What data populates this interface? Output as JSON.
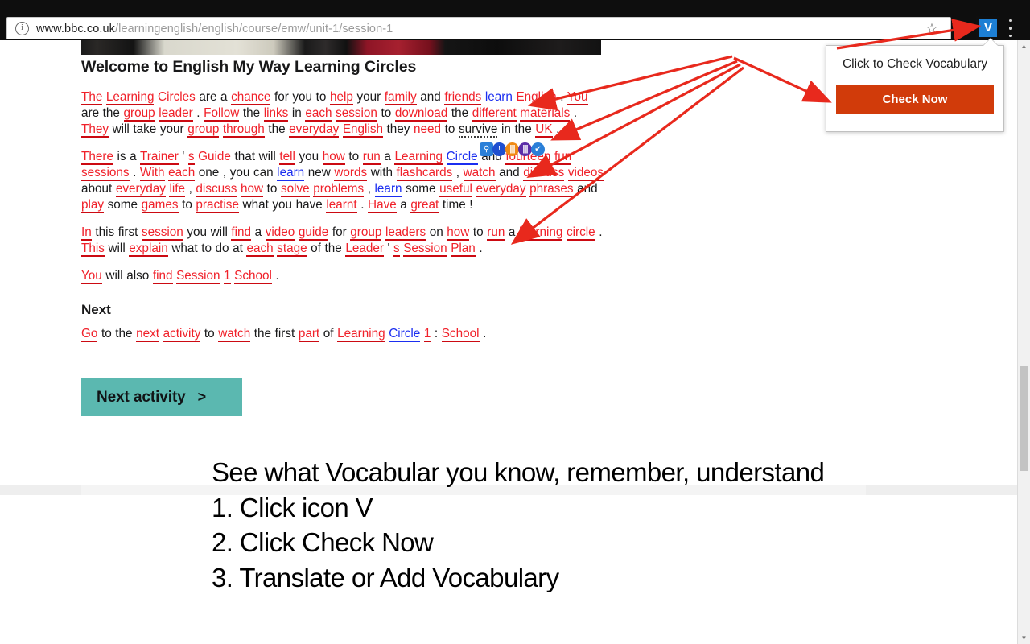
{
  "browser": {
    "url_host": "www.bbc.co.uk",
    "url_path": "/learningenglish/english/course/emw/unit-1/session-1",
    "info_icon": "info-icon",
    "star_icon": "☆",
    "extension_label": "V",
    "menu_icon": "kebab-menu-icon"
  },
  "popup": {
    "title": "Click to Check Vocabulary",
    "button_label": "Check Now",
    "button_color": "#d13b0a"
  },
  "article": {
    "title": "Welcome to English My Way Learning Circles",
    "next_heading": "Next",
    "paragraphs": [
      [
        {
          "t": "The",
          "s": "redu"
        },
        {
          "t": "Learning",
          "s": "redu"
        },
        {
          "t": "Circles",
          "s": "red"
        },
        {
          "t": "are",
          "s": "plain"
        },
        {
          "t": "a",
          "s": "plain"
        },
        {
          "t": "chance",
          "s": "redu"
        },
        {
          "t": "for",
          "s": "plain"
        },
        {
          "t": "you",
          "s": "plain"
        },
        {
          "t": "to",
          "s": "plain"
        },
        {
          "t": "help",
          "s": "redu"
        },
        {
          "t": "your",
          "s": "plain"
        },
        {
          "t": "family",
          "s": "redu"
        },
        {
          "t": "and",
          "s": "plain"
        },
        {
          "t": "friends",
          "s": "redu"
        },
        {
          "t": "learn",
          "s": "blue"
        },
        {
          "t": "English",
          "s": "red"
        },
        {
          "t": ".",
          "s": "plain"
        },
        {
          "t": "You",
          "s": "redu"
        },
        {
          "t": "are",
          "s": "plain"
        },
        {
          "t": "the",
          "s": "plain"
        },
        {
          "t": "group",
          "s": "redu"
        },
        {
          "t": "leader",
          "s": "redu"
        },
        {
          "t": ".",
          "s": "plain"
        },
        {
          "t": "Follow",
          "s": "redu"
        },
        {
          "t": "the",
          "s": "plain"
        },
        {
          "t": "links",
          "s": "redu"
        },
        {
          "t": "in",
          "s": "plain"
        },
        {
          "t": "each",
          "s": "redu"
        },
        {
          "t": "session",
          "s": "redu"
        },
        {
          "t": "to",
          "s": "plain"
        },
        {
          "t": "download",
          "s": "redu"
        },
        {
          "t": "the",
          "s": "plain"
        },
        {
          "t": "different",
          "s": "redu"
        },
        {
          "t": "materials",
          "s": "redu"
        },
        {
          "t": ".",
          "s": "plain"
        },
        {
          "t": "They",
          "s": "redu"
        },
        {
          "t": "will",
          "s": "plain"
        },
        {
          "t": "take",
          "s": "plain"
        },
        {
          "t": "your",
          "s": "plain"
        },
        {
          "t": "group",
          "s": "redu"
        },
        {
          "t": "through",
          "s": "redu"
        },
        {
          "t": "the",
          "s": "plain"
        },
        {
          "t": "everyday",
          "s": "redu"
        },
        {
          "t": "English",
          "s": "redu"
        },
        {
          "t": "they",
          "s": "plain"
        },
        {
          "t": "need",
          "s": "red"
        },
        {
          "t": "to",
          "s": "plain"
        },
        {
          "t": "survive",
          "s": "spell"
        },
        {
          "t": "in",
          "s": "plain"
        },
        {
          "t": "the",
          "s": "plain"
        },
        {
          "t": "UK",
          "s": "redu"
        },
        {
          "t": ".",
          "s": "plain"
        }
      ],
      [
        {
          "t": "There",
          "s": "redu"
        },
        {
          "t": "is",
          "s": "plain"
        },
        {
          "t": "a",
          "s": "plain"
        },
        {
          "t": "Trainer",
          "s": "redu"
        },
        {
          "t": "'",
          "s": "plain"
        },
        {
          "t": "s",
          "s": "redu"
        },
        {
          "t": "Guide",
          "s": "red"
        },
        {
          "t": "that",
          "s": "plain"
        },
        {
          "t": "will",
          "s": "plain"
        },
        {
          "t": "tell",
          "s": "redu"
        },
        {
          "t": "you",
          "s": "plain"
        },
        {
          "t": "how",
          "s": "redu"
        },
        {
          "t": "to",
          "s": "plain"
        },
        {
          "t": "run",
          "s": "redu"
        },
        {
          "t": "a",
          "s": "plain"
        },
        {
          "t": "Learning",
          "s": "redu"
        },
        {
          "t": "Circle",
          "s": "blueu"
        },
        {
          "t": "and",
          "s": "plain"
        },
        {
          "t": "fourteen",
          "s": "redu"
        },
        {
          "t": "fun",
          "s": "redu"
        },
        {
          "t": "sessions",
          "s": "redu"
        },
        {
          "t": ".",
          "s": "plain"
        },
        {
          "t": "With",
          "s": "redu"
        },
        {
          "t": "each",
          "s": "redu"
        },
        {
          "t": "one",
          "s": "plain"
        },
        {
          "t": ",",
          "s": "plain"
        },
        {
          "t": "you",
          "s": "plain"
        },
        {
          "t": "can",
          "s": "plain"
        },
        {
          "t": "learn",
          "s": "blueu"
        },
        {
          "t": "new",
          "s": "plain"
        },
        {
          "t": "words",
          "s": "redu"
        },
        {
          "t": "with",
          "s": "plain"
        },
        {
          "t": "flashcards",
          "s": "redu"
        },
        {
          "t": ",",
          "s": "plain"
        },
        {
          "t": "watch",
          "s": "redu"
        },
        {
          "t": "and",
          "s": "plain"
        },
        {
          "t": "discuss",
          "s": "redu"
        },
        {
          "t": "videos",
          "s": "redu"
        },
        {
          "t": "about",
          "s": "plain"
        },
        {
          "t": "everyday",
          "s": "redu"
        },
        {
          "t": "life",
          "s": "redu"
        },
        {
          "t": ",",
          "s": "plain"
        },
        {
          "t": "discuss",
          "s": "redu"
        },
        {
          "t": "how",
          "s": "redu"
        },
        {
          "t": "to",
          "s": "plain"
        },
        {
          "t": "solve",
          "s": "redu"
        },
        {
          "t": "problems",
          "s": "redu"
        },
        {
          "t": ",",
          "s": "plain"
        },
        {
          "t": "learn",
          "s": "blueu"
        },
        {
          "t": "some",
          "s": "plain"
        },
        {
          "t": "useful",
          "s": "redu"
        },
        {
          "t": "everyday",
          "s": "redu"
        },
        {
          "t": "phrases",
          "s": "redu"
        },
        {
          "t": "and",
          "s": "plain"
        },
        {
          "t": "play",
          "s": "redu"
        },
        {
          "t": "some",
          "s": "plain"
        },
        {
          "t": "games",
          "s": "redu"
        },
        {
          "t": "to",
          "s": "plain"
        },
        {
          "t": "practise",
          "s": "redu"
        },
        {
          "t": "what",
          "s": "plain"
        },
        {
          "t": "you",
          "s": "plain"
        },
        {
          "t": "have",
          "s": "plain"
        },
        {
          "t": "learnt",
          "s": "redu"
        },
        {
          "t": ".",
          "s": "plain"
        },
        {
          "t": "Have",
          "s": "redu"
        },
        {
          "t": "a",
          "s": "plain"
        },
        {
          "t": "great",
          "s": "redu"
        },
        {
          "t": "time",
          "s": "plain"
        },
        {
          "t": "!",
          "s": "plain"
        }
      ],
      [
        {
          "t": "In",
          "s": "redu"
        },
        {
          "t": "this",
          "s": "plain"
        },
        {
          "t": "first",
          "s": "plain"
        },
        {
          "t": "session",
          "s": "redu"
        },
        {
          "t": "you",
          "s": "plain"
        },
        {
          "t": "will",
          "s": "plain"
        },
        {
          "t": "find",
          "s": "redu"
        },
        {
          "t": "a",
          "s": "plain"
        },
        {
          "t": "video",
          "s": "redu"
        },
        {
          "t": "guide",
          "s": "redu"
        },
        {
          "t": "for",
          "s": "plain"
        },
        {
          "t": "group",
          "s": "redu"
        },
        {
          "t": "leaders",
          "s": "redu"
        },
        {
          "t": "on",
          "s": "plain"
        },
        {
          "t": "how",
          "s": "redu"
        },
        {
          "t": "to",
          "s": "plain"
        },
        {
          "t": "run",
          "s": "redu"
        },
        {
          "t": "a",
          "s": "plain"
        },
        {
          "t": "learning",
          "s": "redu"
        },
        {
          "t": "circle",
          "s": "redu"
        },
        {
          "t": ".",
          "s": "plain"
        },
        {
          "t": "This",
          "s": "redu"
        },
        {
          "t": "will",
          "s": "plain"
        },
        {
          "t": "explain",
          "s": "redu"
        },
        {
          "t": "what",
          "s": "plain"
        },
        {
          "t": "to",
          "s": "plain"
        },
        {
          "t": "do",
          "s": "plain"
        },
        {
          "t": "at",
          "s": "plain"
        },
        {
          "t": "each",
          "s": "redu"
        },
        {
          "t": "stage",
          "s": "redu"
        },
        {
          "t": "of",
          "s": "plain"
        },
        {
          "t": "the",
          "s": "plain"
        },
        {
          "t": "Leader",
          "s": "redu"
        },
        {
          "t": "'",
          "s": "plain"
        },
        {
          "t": "s",
          "s": "redu"
        },
        {
          "t": "Session",
          "s": "redu"
        },
        {
          "t": "Plan",
          "s": "redu"
        },
        {
          "t": ".",
          "s": "plain"
        }
      ],
      [
        {
          "t": "You",
          "s": "redu"
        },
        {
          "t": "will",
          "s": "plain"
        },
        {
          "t": "also",
          "s": "plain"
        },
        {
          "t": "find",
          "s": "redu"
        },
        {
          "t": "Session",
          "s": "redu"
        },
        {
          "t": "1",
          "s": "redu"
        },
        {
          "t": "School",
          "s": "redu"
        },
        {
          "t": ".",
          "s": "plain"
        }
      ],
      [
        {
          "t": "Go",
          "s": "redu"
        },
        {
          "t": "to",
          "s": "plain"
        },
        {
          "t": "the",
          "s": "plain"
        },
        {
          "t": "next",
          "s": "redu"
        },
        {
          "t": "activity",
          "s": "redu"
        },
        {
          "t": "to",
          "s": "plain"
        },
        {
          "t": "watch",
          "s": "redu"
        },
        {
          "t": "the",
          "s": "plain"
        },
        {
          "t": "first",
          "s": "plain"
        },
        {
          "t": "part",
          "s": "redu"
        },
        {
          "t": "of",
          "s": "plain"
        },
        {
          "t": "Learning",
          "s": "redu"
        },
        {
          "t": "Circle",
          "s": "blueu"
        },
        {
          "t": "1",
          "s": "redu"
        },
        {
          "t": ":",
          "s": "plain"
        },
        {
          "t": "School",
          "s": "redu"
        },
        {
          "t": ".",
          "s": "plain"
        }
      ]
    ],
    "next_activity_label": "Next activity",
    "next_activity_chevron": ">"
  },
  "inline_toolbar": {
    "icons": [
      "search-icon",
      "info-icon",
      "dictionary-icon",
      "translate-icon",
      "check-icon"
    ]
  },
  "annotation": {
    "heading": "See what Vocabular you know, remember, understand",
    "steps": [
      {
        "num": "1.",
        "text": "Click icon V"
      },
      {
        "num": "2.",
        "text": "Click Check Now"
      },
      {
        "num": "3.",
        "text": "Translate or Add Vocabulary"
      }
    ],
    "arrow_color": "#e8291d"
  },
  "scrollbar": {
    "up_arrow": "▲",
    "down_arrow": "▼"
  }
}
